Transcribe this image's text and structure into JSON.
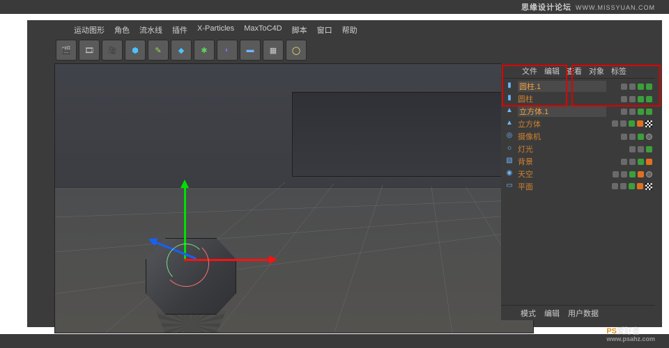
{
  "watermark_top": {
    "brand": "思缘设计论坛",
    "url": "WWW.MISSYUAN.COM"
  },
  "watermark_bottom": {
    "brand_a": "PS",
    "brand_b": "爱好者",
    "url": "www.psahz.com"
  },
  "menu": [
    "运动图形",
    "角色",
    "流水线",
    "插件",
    "X-Particles",
    "MaxToC4D",
    "脚本",
    "窗口",
    "帮助"
  ],
  "object_tabs": [
    "文件",
    "编辑",
    "查看",
    "对象",
    "标签"
  ],
  "attr_tabs": [
    "模式",
    "编辑",
    "用户数据"
  ],
  "objects": [
    {
      "icon": "cyl",
      "name": "圆柱.1",
      "sel": true,
      "c": [
        "dg",
        "dg",
        "dgn",
        "dgn"
      ]
    },
    {
      "icon": "cyl",
      "name": "圆柱",
      "sel": false,
      "c": [
        "dg",
        "dg",
        "dgn",
        "dgn"
      ]
    },
    {
      "icon": "cube",
      "name": "立方体.1",
      "sel": true,
      "c": [
        "dg",
        "dg",
        "dgn",
        "dgn"
      ]
    },
    {
      "icon": "cube",
      "name": "立方体",
      "sel": false,
      "c": [
        "dg",
        "dg",
        "dgn",
        "do",
        "chk"
      ]
    },
    {
      "icon": "cam",
      "name": "摄像机",
      "sel": false,
      "c": [
        "dg",
        "dg",
        "dgn",
        "dn"
      ]
    },
    {
      "icon": "light",
      "name": "灯光",
      "sel": false,
      "c": [
        "dg",
        "dg",
        "dgn"
      ]
    },
    {
      "icon": "bg",
      "name": "背景",
      "sel": false,
      "c": [
        "dg",
        "dg",
        "dgn",
        "do"
      ]
    },
    {
      "icon": "sky",
      "name": "天空",
      "sel": false,
      "c": [
        "dg",
        "dg",
        "dgn",
        "do",
        "dn"
      ]
    },
    {
      "icon": "plane",
      "name": "平面",
      "sel": false,
      "c": [
        "dg",
        "dg",
        "dgn",
        "do",
        "chk"
      ]
    }
  ],
  "icons": {
    "cyl": "▮",
    "cube": "▲",
    "cam": "◎",
    "light": "☼",
    "bg": "▧",
    "sky": "◉",
    "plane": "▭"
  }
}
